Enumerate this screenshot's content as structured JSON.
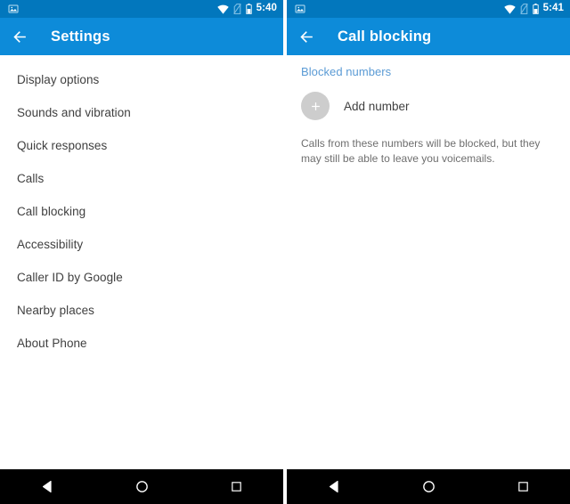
{
  "colors": {
    "status_bar": "#0277bd",
    "app_bar": "#0d8bd9",
    "accent_link": "#5b9bd5",
    "nav_bar": "#000000",
    "list_text": "#3f3f3f",
    "body_text": "#6e6e6e",
    "add_circle": "#cdcdcd"
  },
  "panels": [
    {
      "status_bar": {
        "notification_icon": "image-notification-icon",
        "icons": [
          "wifi-icon",
          "no-sim-icon",
          "battery-icon"
        ],
        "clock": "5:40"
      },
      "app_bar": {
        "back_icon": "back-arrow-icon",
        "title": "Settings"
      },
      "settings_items": [
        {
          "label": "Display options"
        },
        {
          "label": "Sounds and vibration"
        },
        {
          "label": "Quick responses"
        },
        {
          "label": "Calls"
        },
        {
          "label": "Call blocking"
        },
        {
          "label": "Accessibility"
        },
        {
          "label": "Caller ID by Google"
        },
        {
          "label": "Nearby places"
        },
        {
          "label": "About Phone"
        }
      ],
      "nav_bar": {
        "back": "back-triangle-icon",
        "home": "home-circle-icon",
        "recents": "recents-square-icon"
      }
    },
    {
      "status_bar": {
        "notification_icon": "image-notification-icon",
        "icons": [
          "wifi-icon",
          "no-sim-icon",
          "battery-icon"
        ],
        "clock": "5:41"
      },
      "app_bar": {
        "back_icon": "back-arrow-icon",
        "title": "Call blocking"
      },
      "section_header": "Blocked numbers",
      "add_number": {
        "icon": "plus-icon",
        "label": "Add number"
      },
      "blurb": "Calls from these numbers will be blocked, but they may still be able to leave you voicemails.",
      "nav_bar": {
        "back": "back-triangle-icon",
        "home": "home-circle-icon",
        "recents": "recents-square-icon"
      }
    }
  ]
}
